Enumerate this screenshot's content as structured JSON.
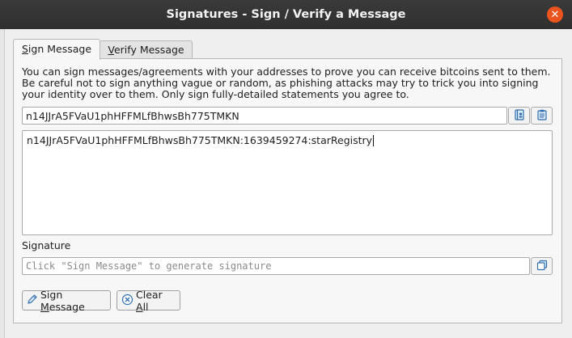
{
  "window": {
    "title": "Signatures - Sign / Verify a Message",
    "close_glyph": "✕"
  },
  "tabs": [
    {
      "label_mnemonic": "S",
      "label_rest": "ign Message",
      "active": true
    },
    {
      "label_mnemonic": "V",
      "label_rest": "erify Message",
      "active": false
    }
  ],
  "sign": {
    "description": "You can sign messages/agreements with your addresses to prove you can receive bitcoins sent to them. Be careful not to sign anything vague or random, as phishing attacks may try to trick you into signing your identity over to them. Only sign fully-detailed statements you agree to.",
    "address_value": "n14JJrA5FVaU1phHFFMLfBhwsBh775TMKN",
    "message_value": "n14JJrA5FVaU1phHFFMLfBhwsBh775TMKN:1639459274:starRegistry",
    "signature_label": "Signature",
    "signature_placeholder": "Click \"Sign Message\" to generate signature",
    "sign_button_pre": "Sign ",
    "sign_button_mnemonic": "M",
    "sign_button_post": "essage",
    "clear_button_pre": "Clear ",
    "clear_button_mnemonic": "A",
    "clear_button_post": "ll"
  },
  "icons": {
    "address_book": "address-book-icon",
    "paste": "paste-icon",
    "copy": "copy-icon",
    "sign": "pen-icon",
    "clear": "clear-icon"
  },
  "colors": {
    "titlebar": "#2f2f2f",
    "close": "#e9541f",
    "accent_icon": "#2f6fb0"
  }
}
